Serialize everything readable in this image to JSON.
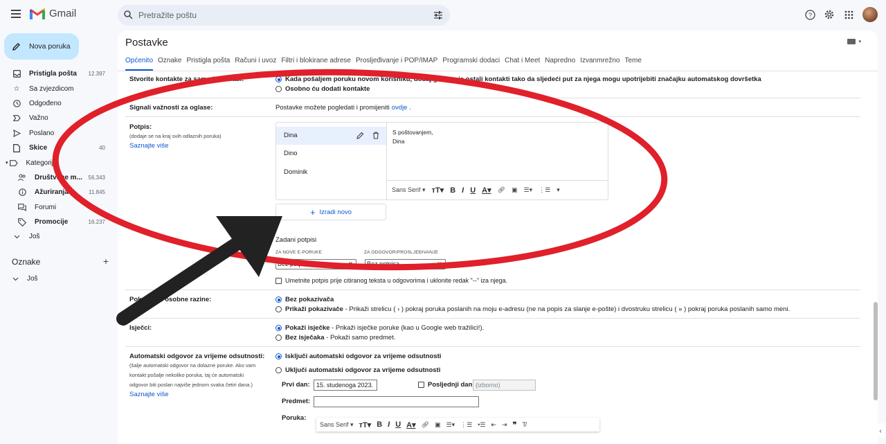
{
  "app": {
    "name": "Gmail"
  },
  "search": {
    "placeholder": "Pretražite poštu"
  },
  "compose": {
    "label": "Nova poruka"
  },
  "sidebar": {
    "items": [
      {
        "label": "Pristigla pošta",
        "count": "12.397",
        "icon": "inbox-icon",
        "bold": true
      },
      {
        "label": "Sa zvjezdicom",
        "count": "",
        "icon": "star-icon",
        "bold": false
      },
      {
        "label": "Odgođeno",
        "count": "",
        "icon": "clock-icon",
        "bold": false
      },
      {
        "label": "Važno",
        "count": "",
        "icon": "important-icon",
        "bold": false
      },
      {
        "label": "Poslano",
        "count": "",
        "icon": "send-icon",
        "bold": false
      },
      {
        "label": "Skice",
        "count": "40",
        "icon": "draft-icon",
        "bold": true
      },
      {
        "label": "Kategorije",
        "count": "",
        "icon": "label-icon",
        "bold": false
      },
      {
        "label": "Društvene m...",
        "count": "56.343",
        "icon": "people-icon",
        "bold": true
      },
      {
        "label": "Ažuriranja",
        "count": "11.845",
        "icon": "info-icon",
        "bold": true
      },
      {
        "label": "Forumi",
        "count": "",
        "icon": "forum-icon",
        "bold": false
      },
      {
        "label": "Promocije",
        "count": "16.237",
        "icon": "tag-icon",
        "bold": true
      },
      {
        "label": "Još",
        "count": "",
        "icon": "chevron-down-icon",
        "bold": false
      }
    ],
    "labels_title": "Oznake",
    "labels_more": "Još"
  },
  "settings": {
    "title": "Postavke",
    "tabs": [
      "Općenito",
      "Oznake",
      "Pristigla pošta",
      "Računi i uvoz",
      "Filtri i blokirane adrese",
      "Prosljeđivanje i POP/IMAP",
      "Programski dodaci",
      "Chat i Meet",
      "Napredno",
      "Izvanmrežno",
      "Teme"
    ],
    "contacts": {
      "label": "Stvorite kontakte za samodovršetak:",
      "opt1": "Kada pošaljem poruku novom korisniku, dodaj ga u moje ostali kontakti tako da sljedeći put za njega mogu upotrijebiti značajku automatskog dovršetka",
      "opt2": "Osobno ću dodati kontakte"
    },
    "ads": {
      "label": "Signali važnosti za oglase:",
      "text": "Postavke možete pogledati i promijeniti",
      "link": "ovdje",
      "dot": "."
    },
    "signature": {
      "label": "Potpis:",
      "note": "(dodaje se na kraj svih odlaznih poruka)",
      "learn_more": "Saznajte više",
      "names": [
        "Dina",
        "Dino",
        "Dominik"
      ],
      "body_line1": "S poštovanjem,",
      "body_line2": "Dina",
      "font": "Sans Serif",
      "new_button": "Izradi novo",
      "defaults_title": "Zadani potpisi",
      "new_mail_label": "ZA NOVE E-PORUKE",
      "reply_label": "ZA ODGOVOR/PROSLJEĐIVANJE",
      "new_mail_value": "Bez potpisa",
      "reply_value": "Bez potpisa",
      "insert_text": "Umetnite potpis prije citiranog teksta u odgovorima i uklonite redak \"--\" iza njega."
    },
    "indicators": {
      "label": "Pokazivači osobne razine:",
      "opt1": "Bez pokazivača",
      "opt2_bold": "Prikaži pokazivače",
      "opt2_rest": " - Prikaži strelicu ( › ) pokraj poruka poslanih na moju e-adresu (ne na popis za slanje e-pošte) i dvostruku strelicu ( » ) pokraj poruka poslanih samo meni."
    },
    "snippets": {
      "label": "Isječci:",
      "opt1_bold": "Pokaži isječke",
      "opt1_rest": " - Prikaži isječke poruke (kao u Google web tražilici!).",
      "opt2_bold": "Bez isječaka",
      "opt2_rest": " - Pokaži samo predmet."
    },
    "vacation": {
      "label": "Automatski odgovor za vrijeme odsutnosti:",
      "note1": "(šalje automatski odgovor na dolazne poruke. Ako vam",
      "note2": "kontakt pošalje nekoliko poruka, taj će automatski",
      "note3": "odgovor biti poslan najviše jednom svaka četiri dana.)",
      "learn_more": "Saznajte više",
      "opt1": "Isključi automatski odgovor za vrijeme odsutnosti",
      "opt2": "Uključi automatski odgovor za vrijeme odsutnosti",
      "first_day_label": "Prvi dan:",
      "first_day_value": "15. studenoga 2023.",
      "last_day_label": "Posljednji dan:",
      "last_day_placeholder": "(izborno)",
      "subject_label": "Predmet:",
      "message_label": "Poruka:",
      "font": "Sans Serif"
    }
  }
}
